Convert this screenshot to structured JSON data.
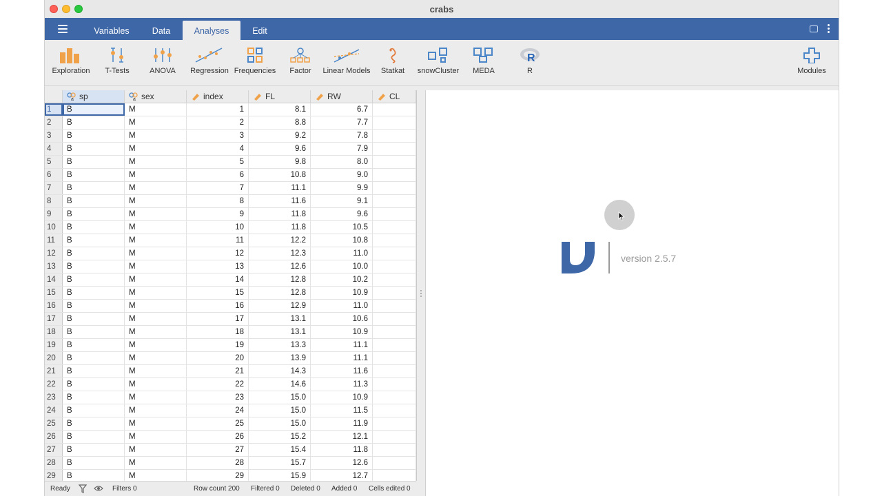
{
  "window": {
    "title": "crabs"
  },
  "menu": {
    "tabs": [
      {
        "label": "Variables",
        "active": false
      },
      {
        "label": "Data",
        "active": false
      },
      {
        "label": "Analyses",
        "active": true
      },
      {
        "label": "Edit",
        "active": false
      }
    ]
  },
  "ribbon": {
    "items": [
      {
        "label": "Exploration",
        "icon": "exploration-icon"
      },
      {
        "label": "T-Tests",
        "icon": "ttests-icon"
      },
      {
        "label": "ANOVA",
        "icon": "anova-icon"
      },
      {
        "label": "Regression",
        "icon": "regression-icon"
      },
      {
        "label": "Frequencies",
        "icon": "frequencies-icon"
      },
      {
        "label": "Factor",
        "icon": "factor-icon"
      },
      {
        "label": "Linear Models",
        "icon": "linear-models-icon"
      },
      {
        "label": "Statkat",
        "icon": "statkat-icon"
      },
      {
        "label": "snowCluster",
        "icon": "snowcluster-icon"
      },
      {
        "label": "MEDA",
        "icon": "meda-icon"
      },
      {
        "label": "R",
        "icon": "r-icon"
      },
      {
        "label": "Modules",
        "icon": "modules-icon"
      }
    ]
  },
  "spreadsheet": {
    "columns": [
      {
        "name": "sp",
        "type": "nominal-text"
      },
      {
        "name": "sex",
        "type": "nominal-text"
      },
      {
        "name": "index",
        "type": "continuous"
      },
      {
        "name": "FL",
        "type": "continuous"
      },
      {
        "name": "RW",
        "type": "continuous"
      },
      {
        "name": "CL",
        "type": "continuous"
      }
    ],
    "rows": [
      [
        "1",
        "B",
        "M",
        "1",
        "8.1",
        "6.7"
      ],
      [
        "2",
        "B",
        "M",
        "2",
        "8.8",
        "7.7"
      ],
      [
        "3",
        "B",
        "M",
        "3",
        "9.2",
        "7.8"
      ],
      [
        "4",
        "B",
        "M",
        "4",
        "9.6",
        "7.9"
      ],
      [
        "5",
        "B",
        "M",
        "5",
        "9.8",
        "8.0"
      ],
      [
        "6",
        "B",
        "M",
        "6",
        "10.8",
        "9.0"
      ],
      [
        "7",
        "B",
        "M",
        "7",
        "11.1",
        "9.9"
      ],
      [
        "8",
        "B",
        "M",
        "8",
        "11.6",
        "9.1"
      ],
      [
        "9",
        "B",
        "M",
        "9",
        "11.8",
        "9.6"
      ],
      [
        "10",
        "B",
        "M",
        "10",
        "11.8",
        "10.5"
      ],
      [
        "11",
        "B",
        "M",
        "11",
        "12.2",
        "10.8"
      ],
      [
        "12",
        "B",
        "M",
        "12",
        "12.3",
        "11.0"
      ],
      [
        "13",
        "B",
        "M",
        "13",
        "12.6",
        "10.0"
      ],
      [
        "14",
        "B",
        "M",
        "14",
        "12.8",
        "10.2"
      ],
      [
        "15",
        "B",
        "M",
        "15",
        "12.8",
        "10.9"
      ],
      [
        "16",
        "B",
        "M",
        "16",
        "12.9",
        "11.0"
      ],
      [
        "17",
        "B",
        "M",
        "17",
        "13.1",
        "10.6"
      ],
      [
        "18",
        "B",
        "M",
        "18",
        "13.1",
        "10.9"
      ],
      [
        "19",
        "B",
        "M",
        "19",
        "13.3",
        "11.1"
      ],
      [
        "20",
        "B",
        "M",
        "20",
        "13.9",
        "11.1"
      ],
      [
        "21",
        "B",
        "M",
        "21",
        "14.3",
        "11.6"
      ],
      [
        "22",
        "B",
        "M",
        "22",
        "14.6",
        "11.3"
      ],
      [
        "23",
        "B",
        "M",
        "23",
        "15.0",
        "10.9"
      ],
      [
        "24",
        "B",
        "M",
        "24",
        "15.0",
        "11.5"
      ],
      [
        "25",
        "B",
        "M",
        "25",
        "15.0",
        "11.9"
      ],
      [
        "26",
        "B",
        "M",
        "26",
        "15.2",
        "12.1"
      ],
      [
        "27",
        "B",
        "M",
        "27",
        "15.4",
        "11.8"
      ],
      [
        "28",
        "B",
        "M",
        "28",
        "15.7",
        "12.6"
      ],
      [
        "29",
        "B",
        "M",
        "29",
        "15.9",
        "12.7"
      ]
    ]
  },
  "results": {
    "version": "version 2.5.7"
  },
  "status": {
    "ready": "Ready",
    "filters": "Filters 0",
    "row_count": "Row count 200",
    "filtered": "Filtered 0",
    "deleted": "Deleted 0",
    "added": "Added 0",
    "cells_edited": "Cells edited 0"
  },
  "colors": {
    "accent": "#3e67a8",
    "ribbon_orange": "#f0a24a",
    "ribbon_blue": "#4a86c8"
  }
}
